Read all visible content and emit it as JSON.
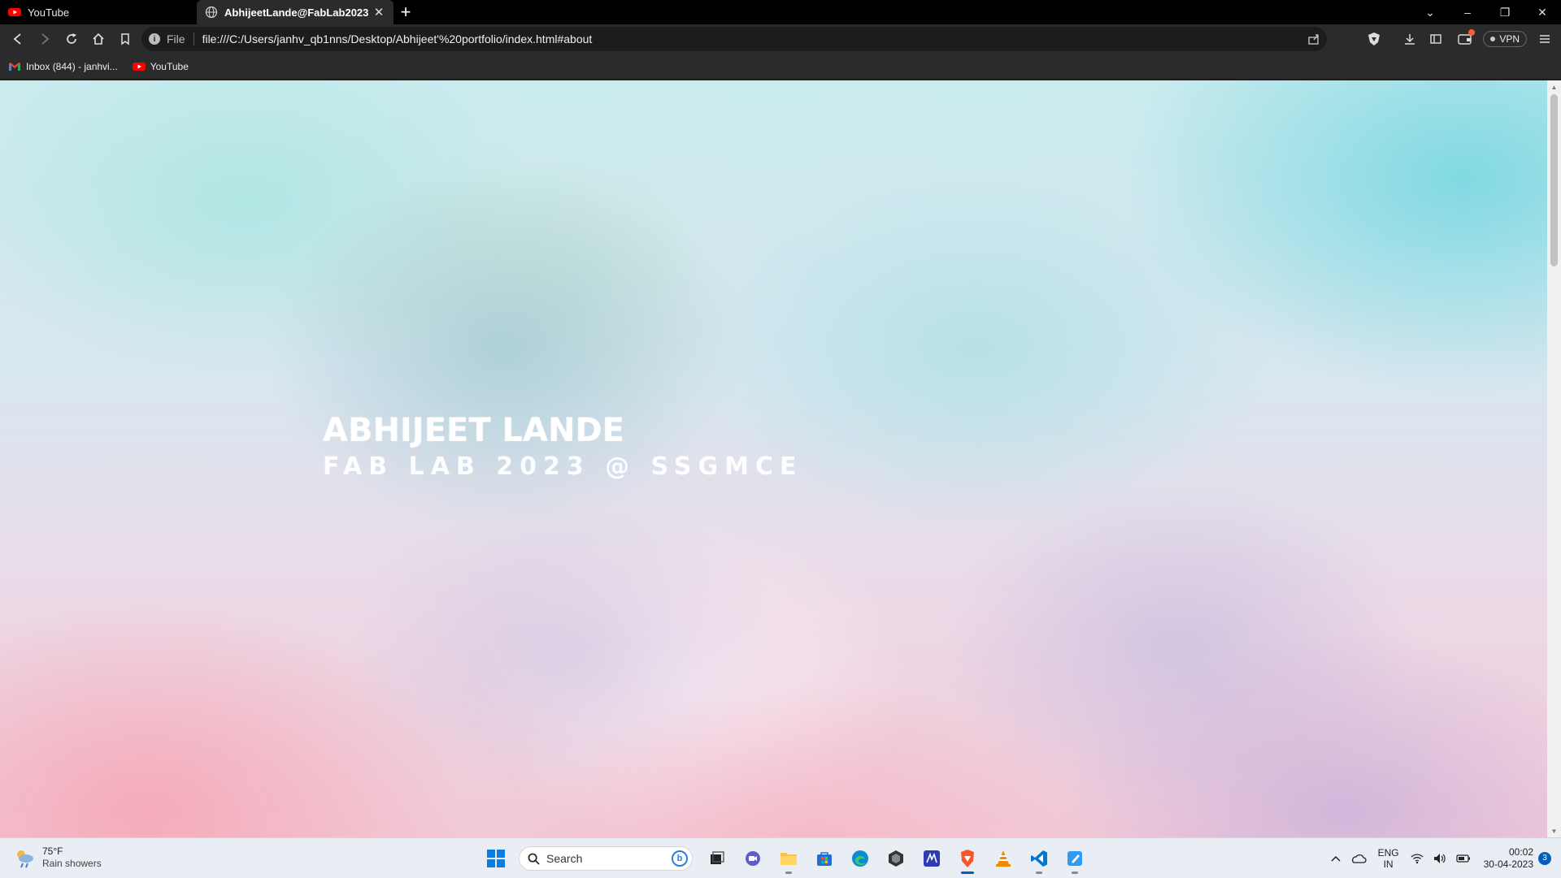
{
  "browser": {
    "tabs": [
      {
        "title": "YouTube",
        "active": false,
        "icon": "youtube-icon"
      },
      {
        "title": "AbhijeetLande@FabLab2023",
        "active": true,
        "icon": "globe-icon"
      }
    ],
    "new_tab_label": "+",
    "window_controls": {
      "minimize": "–",
      "restore": "❐",
      "close": "✕"
    },
    "address": {
      "scheme_label": "File",
      "url": "file:///C:/Users/janhv_qb1nns/Desktop/Abhijeet'%20portfolio/index.html#about"
    },
    "vpn_label": "VPN",
    "bookmarks": [
      {
        "label": "Inbox (844) - janhvi...",
        "icon": "gmail-icon"
      },
      {
        "label": "YouTube",
        "icon": "youtube-icon"
      }
    ]
  },
  "page": {
    "name": "ABHIJEET LANDE",
    "subtitle": "FAB LAB 2023 @ SSGMCE"
  },
  "taskbar": {
    "weather": {
      "temp": "75°F",
      "condition": "Rain showers"
    },
    "search_label": "Search",
    "tray": {
      "lang_top": "ENG",
      "lang_bottom": "IN",
      "time": "00:02",
      "date": "30-04-2023",
      "notifications": "3"
    }
  },
  "colors": {
    "accent": "#005fb8",
    "youtube_red": "#ff0000",
    "brave_orange": "#fb542b"
  }
}
